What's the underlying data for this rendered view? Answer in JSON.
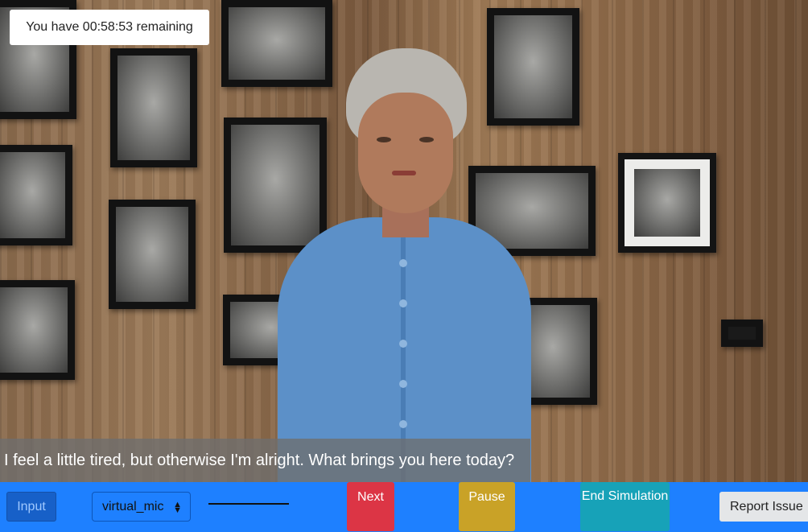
{
  "timer": {
    "text": "You have 00:58:53 remaining"
  },
  "dialogue": {
    "subtitle": "I feel a little tired, but otherwise I'm alright. What brings you here today?"
  },
  "controls": {
    "input_label": "Input",
    "mic_select_value": "virtual_mic",
    "next_label": "Next",
    "pause_label": "Pause",
    "end_label": "End Simulation",
    "report_label": "Report Issue"
  },
  "colors": {
    "control_bar": "#1e80ff",
    "next": "#dc3545",
    "pause": "#c9a227",
    "end": "#17a2b8",
    "report": "#e4e6e8"
  }
}
